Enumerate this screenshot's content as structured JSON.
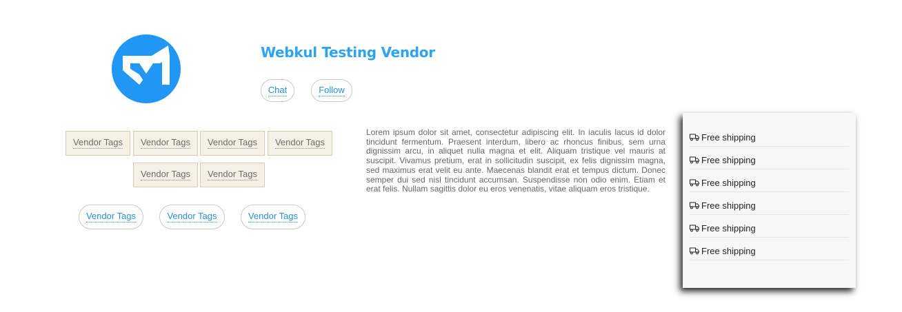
{
  "vendor": {
    "name": "Webkul Testing Vendor",
    "logo_icon": "webkul-logo-icon",
    "brand_color": "#2196f3"
  },
  "actions": {
    "chat_label": "Chat",
    "follow_label": "Follow"
  },
  "tags": {
    "boxed": [
      "Vendor Tags",
      "Vendor Tags",
      "Vendor Tags",
      "Vendor Tags",
      "Vendor Tags",
      "Vendor Tags"
    ],
    "pills": [
      "Vendor Tags",
      "Vendor Tags",
      "Vendor Tags"
    ]
  },
  "description": "Lorem ipsum dolor sit amet, consectetur adipiscing elit. In iaculis lacus id dolor tincidunt fermentum. Praesent interdum, libero ac rhoncus finibus, sem urna dignissim arcu, in aliquet nulla magna et elit. Aliquam tristique vel mauris at suscipit. Vivamus pretium, erat in sollicitudin suscipit, ex felis dignissim magna, sed maximus erat velit eu ante. Maecenas blandit erat et tempus dictum. Donec semper dui sed nisl tincidunt accumsan. Suspendisse non odio enim. Etiam et erat felis. Nullam sagittis dolor eu eros venenatis, vitae aliquam eros tristique.",
  "shipping": {
    "icon": "truck-icon",
    "items": [
      "Free shipping",
      "Free shipping",
      "Free shipping",
      "Free shipping",
      "Free shipping",
      "Free shipping"
    ]
  }
}
